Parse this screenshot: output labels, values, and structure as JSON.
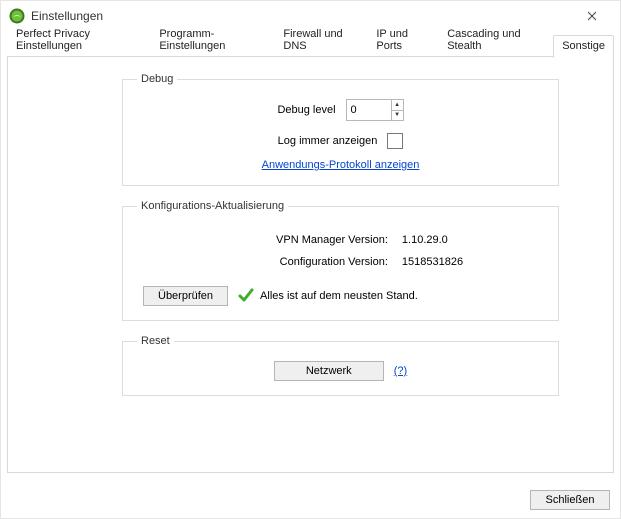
{
  "window": {
    "title": "Einstellungen",
    "close_button": "✕"
  },
  "tabs": [
    {
      "label": "Perfect Privacy Einstellungen"
    },
    {
      "label": "Programm-Einstellungen"
    },
    {
      "label": "Firewall und DNS"
    },
    {
      "label": "IP und Ports"
    },
    {
      "label": "Cascading und Stealth"
    },
    {
      "label": "Sonstige"
    }
  ],
  "debug": {
    "legend": "Debug",
    "level_label": "Debug level",
    "level_value": "0",
    "log_always_label": "Log immer anzeigen",
    "log_always_checked": false,
    "show_app_log_link": "Anwendungs-Protokoll anzeigen"
  },
  "config_update": {
    "legend": "Konfigurations-Aktualisierung",
    "vpn_manager_label": "VPN Manager Version:",
    "vpn_manager_value": "1.10.29.0",
    "config_version_label": "Configuration Version:",
    "config_version_value": "1518531826",
    "check_button": "Überprüfen",
    "status_text": "Alles ist auf dem neusten Stand."
  },
  "reset": {
    "legend": "Reset",
    "network_button": "Netzwerk",
    "help_link": "(?)"
  },
  "footer": {
    "close_button": "Schließen"
  }
}
